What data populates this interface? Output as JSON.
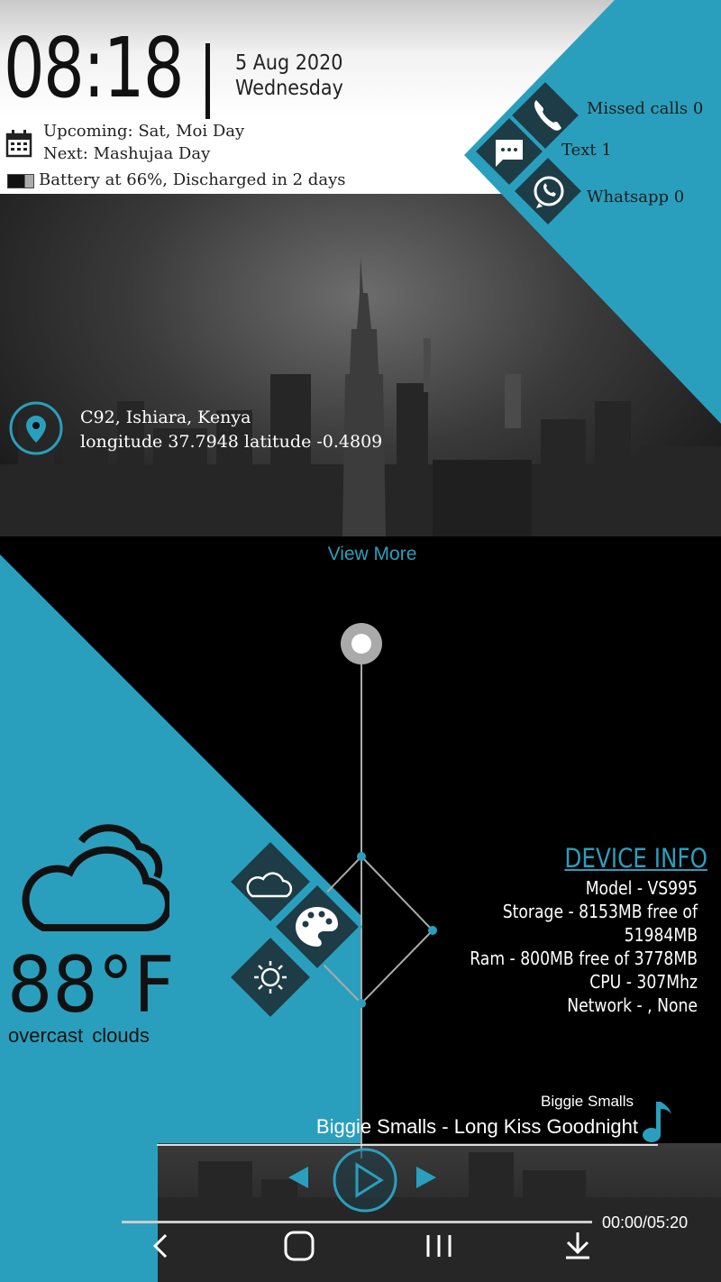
{
  "colors": {
    "accent": "#2a9fbd",
    "tile": "#1e3c46",
    "header_bg": "#ffffff"
  },
  "clock": {
    "time": "08:18",
    "date": "5 Aug 2020",
    "weekday": "Wednesday"
  },
  "events": {
    "upcoming": "Upcoming: Sat, Moi Day",
    "next": "Next: Mashujaa Day"
  },
  "battery": {
    "text": "Battery at 66%, Discharged in 2 days",
    "level": 0.66
  },
  "notifications": {
    "calls": "Missed calls 0",
    "text": "Text 1",
    "whatsapp": "Whatsapp 0",
    "icons": [
      "phone-icon",
      "message-icon",
      "whatsapp-icon"
    ]
  },
  "location": {
    "place": "C92, Ishiara, Kenya",
    "coords": "longitude 37.7948 latitude -0.4809"
  },
  "view_more": "View More",
  "device_info": {
    "title": "DEVICE INFO",
    "model": "Model - VS995",
    "storage": "Storage - 8153MB free of 51984MB",
    "ram": "Ram - 800MB free of 3778MB",
    "cpu": "CPU - 307Mhz",
    "network": "Network - , None"
  },
  "weather": {
    "temp": "88°F",
    "condition": "overcast  clouds",
    "icon": "cloud-icon"
  },
  "launcher_icons": [
    "weather-app-icon",
    "theme-palette-icon",
    "brightness-icon"
  ],
  "music": {
    "artist": "Biggie Smalls",
    "track": "Biggie Smalls - Long Kiss Goodnight",
    "time": "00:00/05:20"
  },
  "navbar": [
    "back-icon",
    "home-icon",
    "recents-icon",
    "download-icon"
  ]
}
